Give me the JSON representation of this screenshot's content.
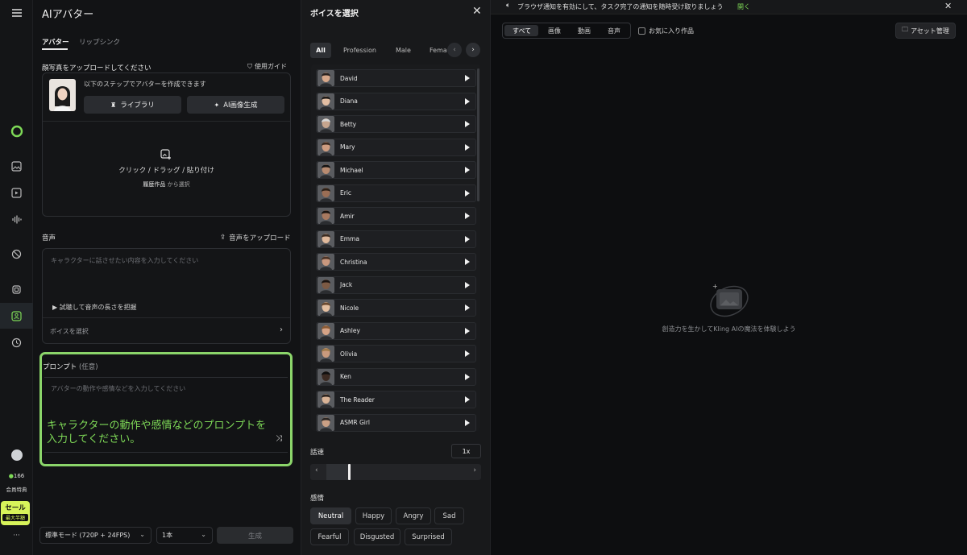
{
  "rail": {
    "credits": "166",
    "member_label": "会員特典",
    "sale": "セール",
    "sale_sub": "最大半額",
    "more": "···"
  },
  "left": {
    "title": "AIアバター",
    "tabs": [
      "アバター",
      "リップシンク"
    ],
    "upload_label": "顔写真をアップロードしてください",
    "guide": "使用ガイド",
    "steps_text": "以下のステップでアバターを作成できます",
    "library_btn": "ライブラリ",
    "ai_image_btn": "AI画像生成",
    "drop_text": "クリック / ドラッグ / 貼り付け",
    "history_link": "履歴作品",
    "history_suffix": "から選択",
    "audio_label": "音声",
    "audio_upload": "音声をアップロード",
    "audio_placeholder": "キャラクターに話させたい内容を入力してください",
    "trial_text": "試聴して音声の長さを把握",
    "voice_select": "ボイスを選択",
    "prompt_label": "プロンプト",
    "prompt_optional": "(任意)",
    "prompt_placeholder": "アバターの動作や感情などを入力してください",
    "annotation": "キャラクターの動作や感情などのプロンプトを入力してください。",
    "mode_select": "標準モード (720P + 24FPS)",
    "count_select": "1本",
    "generate_btn": "生成"
  },
  "voice_panel": {
    "title": "ボイスを選択",
    "filters": [
      "All",
      "Profession",
      "Male",
      "Fema"
    ],
    "voices": [
      "David",
      "Diana",
      "Betty",
      "Mary",
      "Michael",
      "Eric",
      "Amir",
      "Emma",
      "Christina",
      "Jack",
      "Nicole",
      "Ashley",
      "Olivia",
      "Ken",
      "The Reader",
      "ASMR Girl"
    ],
    "speed_label": "話速",
    "speed_value": "1x",
    "emotion_label": "感情",
    "emotions": [
      "Neutral",
      "Happy",
      "Angry",
      "Sad",
      "Fearful",
      "Disgusted",
      "Surprised"
    ],
    "selected_emotion": "Neutral"
  },
  "right": {
    "notice": "ブラウザ通知を有効にして、タスク完了の通知を随時受け取りましょう",
    "notice_link": "開く",
    "filter_tabs": [
      "すべて",
      "画像",
      "動画",
      "音声"
    ],
    "favorites": "お気に入り作品",
    "asset_btn": "アセット管理",
    "empty_text": "創造力を生かしてKling AIの魔法を体験しよう"
  },
  "colors": {
    "accent": "#7ed957",
    "highlight_border": "#8bd56a",
    "bg": "#0d0e10"
  }
}
